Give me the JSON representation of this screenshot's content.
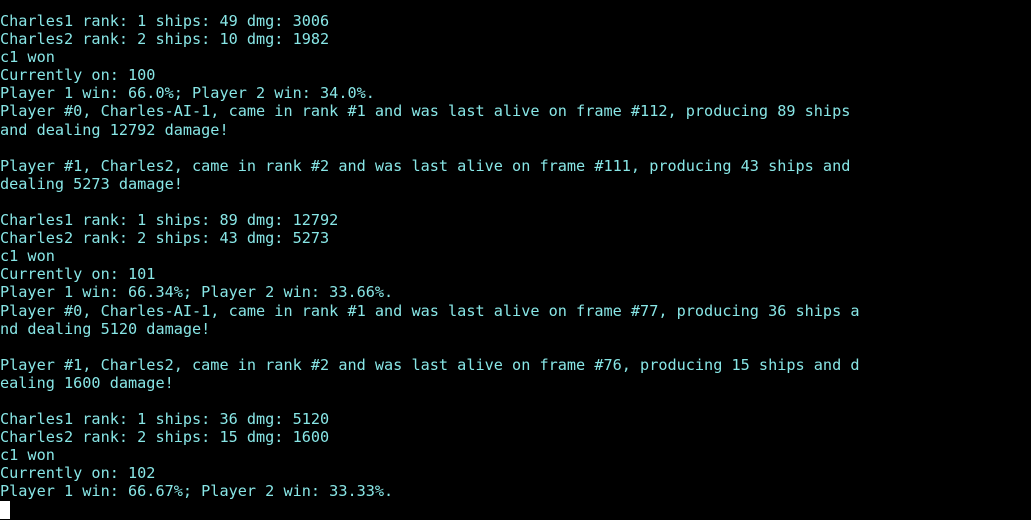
{
  "terminal": {
    "colors": {
      "background": "#000000",
      "foreground": "#88e6e6",
      "cursor": "#ffffff"
    },
    "cursor": {
      "shape": "block",
      "column": 0,
      "row": 28
    },
    "columns": 94,
    "rows": 28,
    "lines": [
      "Charles1 rank: 1 ships: 49 dmg: 3006",
      "Charles2 rank: 2 ships: 10 dmg: 1982",
      "c1 won",
      "Currently on: 100",
      "Player 1 win: 66.0%; Player 2 win: 34.0%.",
      "Player #0, Charles-AI-1, came in rank #1 and was last alive on frame #112, producing 89 ships",
      "and dealing 12792 damage!",
      "",
      "Player #1, Charles2, came in rank #2 and was last alive on frame #111, producing 43 ships and",
      "dealing 5273 damage!",
      "",
      "Charles1 rank: 1 ships: 89 dmg: 12792",
      "Charles2 rank: 2 ships: 43 dmg: 5273",
      "c1 won",
      "Currently on: 101",
      "Player 1 win: 66.34%; Player 2 win: 33.66%.",
      "Player #0, Charles-AI-1, came in rank #1 and was last alive on frame #77, producing 36 ships a",
      "nd dealing 5120 damage!",
      "",
      "Player #1, Charles2, came in rank #2 and was last alive on frame #76, producing 15 ships and d",
      "ealing 1600 damage!",
      "",
      "Charles1 rank: 1 ships: 36 dmg: 5120",
      "Charles2 rank: 2 ships: 15 dmg: 1600",
      "c1 won",
      "Currently on: 102",
      "Player 1 win: 66.67%; Player 2 win: 33.33%.",
      ""
    ]
  },
  "log_data": {
    "matches": [
      {
        "iteration": "100",
        "player1_win_pct": "66.0%",
        "player2_win_pct": "34.0%",
        "winner": "c1",
        "results": [
          {
            "name": "Charles1",
            "rank": "1",
            "ships": "49",
            "dmg": "3006"
          },
          {
            "name": "Charles2",
            "rank": "2",
            "ships": "10",
            "dmg": "1982"
          }
        ]
      },
      {
        "iteration": "101",
        "player1_win_pct": "66.34%",
        "player2_win_pct": "33.66%",
        "winner": "c1",
        "results": [
          {
            "name": "Charles1",
            "rank": "1",
            "ships": "89",
            "dmg": "12792"
          },
          {
            "name": "Charles2",
            "rank": "2",
            "ships": "43",
            "dmg": "5273"
          }
        ],
        "players": [
          {
            "index": "#0",
            "name": "Charles-AI-1",
            "rank": "#1",
            "frame": "#112",
            "ships": "89",
            "damage": "12792"
          },
          {
            "index": "#1",
            "name": "Charles2",
            "rank": "#2",
            "frame": "#111",
            "ships": "43",
            "damage": "5273"
          }
        ]
      },
      {
        "iteration": "102",
        "player1_win_pct": "66.67%",
        "player2_win_pct": "33.33%",
        "winner": "c1",
        "results": [
          {
            "name": "Charles1",
            "rank": "1",
            "ships": "36",
            "dmg": "5120"
          },
          {
            "name": "Charles2",
            "rank": "2",
            "ships": "15",
            "dmg": "1600"
          }
        ],
        "players": [
          {
            "index": "#0",
            "name": "Charles-AI-1",
            "rank": "#1",
            "frame": "#77",
            "ships": "36",
            "damage": "5120"
          },
          {
            "index": "#1",
            "name": "Charles2",
            "rank": "#2",
            "frame": "#76",
            "ships": "15",
            "damage": "1600"
          }
        ]
      }
    ]
  }
}
